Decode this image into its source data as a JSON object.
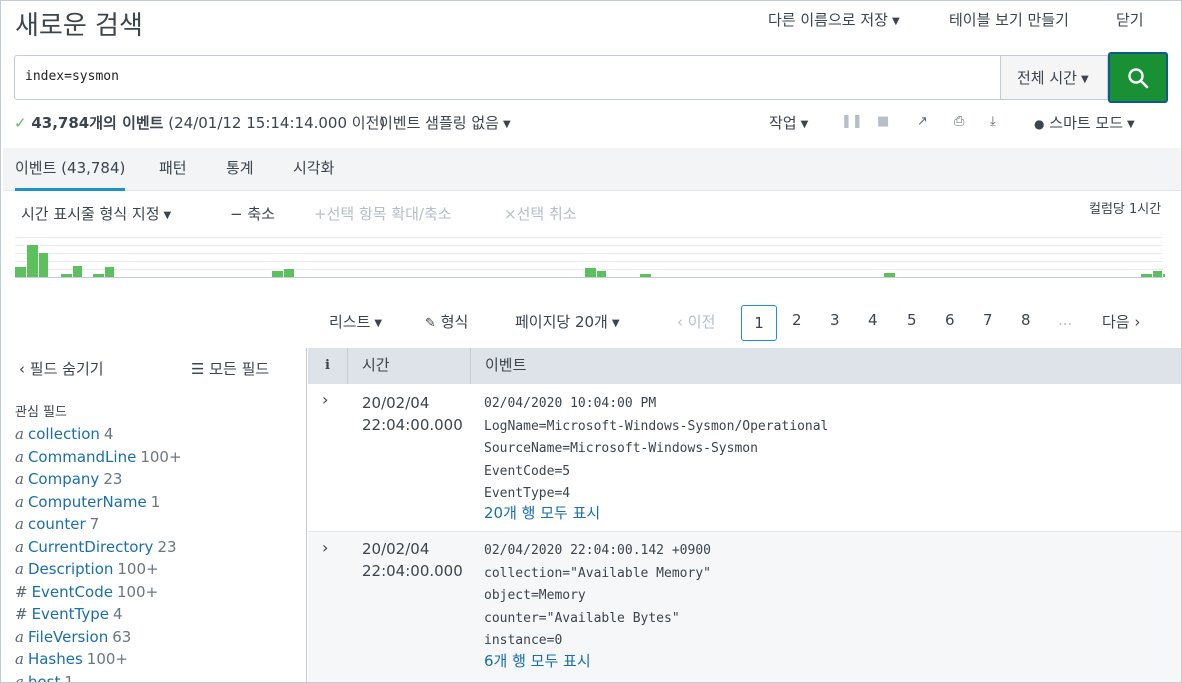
{
  "header": {
    "title": "새로운 검색",
    "save_as": "다른 이름으로 저장",
    "create_table": "테이블 보기 만들기",
    "close": "닫기"
  },
  "search": {
    "query": "index=sysmon",
    "time_range": "전체 시간"
  },
  "status": {
    "check": "✓",
    "count": "43,784개의 이벤트",
    "time": "(24/01/12 15:14:14.000 이전)",
    "sampling": "이벤트 샘플링 없음",
    "job": "작업",
    "mode": "스마트 모드"
  },
  "tabs": [
    {
      "label": "이벤트 (43,784)"
    },
    {
      "label": "패턴"
    },
    {
      "label": "통계"
    },
    {
      "label": "시각화"
    }
  ],
  "timeline": {
    "format": "시간 표시줄 형식 지정",
    "zoom_out": "축소",
    "zoom_selection": "선택 항목 확대/축소",
    "deselect": "선택 취소",
    "per_column": "컬럼당 1시간",
    "bars": [
      0.3,
      1.0,
      0.75,
      0.1,
      0.35,
      0.1,
      0.3,
      0.18,
      0.25,
      0.28,
      0.2,
      0.08,
      0.12,
      0.1,
      0.2,
      0.08
    ]
  },
  "pager": {
    "list": "리스트",
    "format": "형식",
    "per_page": "페이지당 20개",
    "prev": "이전",
    "pages": [
      "1",
      "2",
      "3",
      "4",
      "5",
      "6",
      "7",
      "8",
      "..."
    ],
    "next": "다음"
  },
  "sidebar": {
    "hide_fields": "필드 숨기기",
    "all_fields": "모든 필드",
    "interesting": "관심 필드",
    "fields": [
      {
        "type": "a",
        "name": "collection",
        "count": "4"
      },
      {
        "type": "a",
        "name": "CommandLine",
        "count": "100+"
      },
      {
        "type": "a",
        "name": "Company",
        "count": "23"
      },
      {
        "type": "a",
        "name": "ComputerName",
        "count": "1"
      },
      {
        "type": "a",
        "name": "counter",
        "count": "7"
      },
      {
        "type": "a",
        "name": "CurrentDirectory",
        "count": "23"
      },
      {
        "type": "a",
        "name": "Description",
        "count": "100+"
      },
      {
        "type": "#",
        "name": "EventCode",
        "count": "100+"
      },
      {
        "type": "#",
        "name": "EventType",
        "count": "4"
      },
      {
        "type": "a",
        "name": "FileVersion",
        "count": "63"
      },
      {
        "type": "a",
        "name": "Hashes",
        "count": "100+"
      },
      {
        "type": "a",
        "name": "host",
        "count": "1"
      }
    ]
  },
  "table": {
    "col_info": "i",
    "col_time": "시간",
    "col_event": "이벤트",
    "events": [
      {
        "date": "20/02/04",
        "time": "22:04:00.000",
        "lines": [
          "02/04/2020 10:04:00 PM",
          "LogName=Microsoft-Windows-Sysmon/Operational",
          "SourceName=Microsoft-Windows-Sysmon",
          "EventCode=5",
          "EventType=4"
        ],
        "show_all": "20개 행 모두 표시"
      },
      {
        "date": "20/02/04",
        "time": "22:04:00.000",
        "lines": [
          "02/04/2020 22:04:00.142 +0900",
          "collection=\"Available Memory\"",
          "object=Memory",
          "counter=\"Available Bytes\"",
          "instance=0"
        ],
        "show_all": "6개 행 모두 표시"
      }
    ]
  },
  "colors": {
    "accent": "#1e93c6",
    "go_button": "#1a9035",
    "bar": "#5cc05c",
    "link": "#1a6fa8"
  }
}
